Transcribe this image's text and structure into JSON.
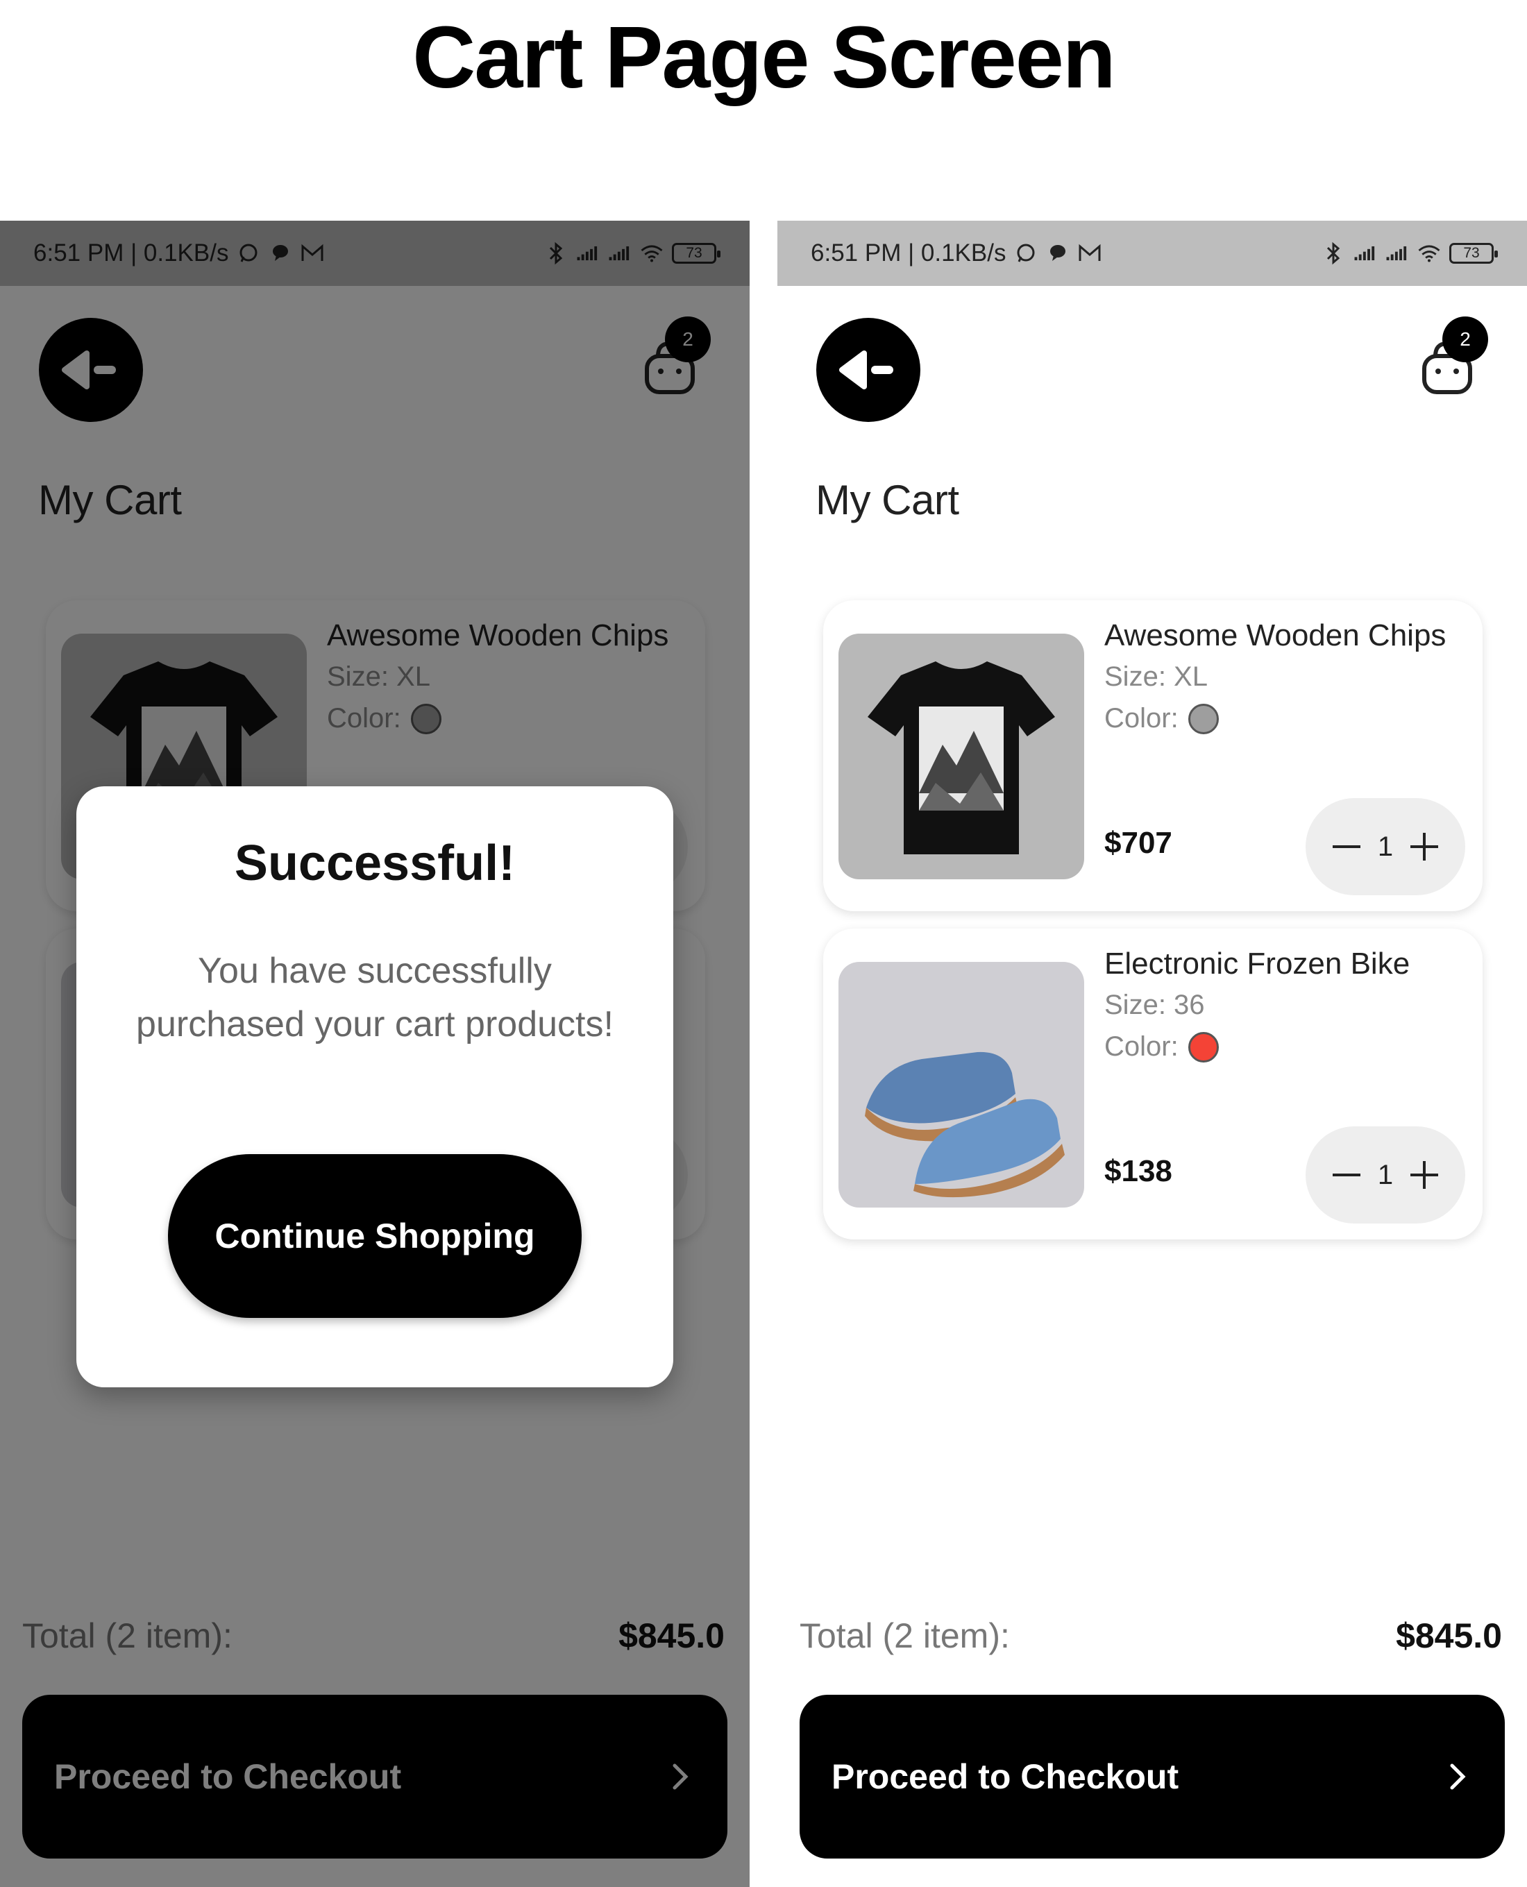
{
  "heading": "Cart Page Screen",
  "status_bar": {
    "time_speed": "6:51 PM | 0.1KB/s",
    "battery": "73"
  },
  "cart": {
    "badge_count": "2",
    "title": "My Cart",
    "items": [
      {
        "name": "Awesome Wooden Chips",
        "size": "Size: XL",
        "color_label": "Color:",
        "color": "#9e9e9e",
        "price": "$707",
        "quantity": "1",
        "image_icon": "tshirt-image"
      },
      {
        "name": "Electronic Frozen Bike",
        "size": "Size: 36",
        "color_label": "Color:",
        "color": "#f44336",
        "price": "$138",
        "quantity": "1",
        "image_icon": "shoe-image"
      }
    ],
    "total_label": "Total (2 item):",
    "total_value": "$845.0",
    "checkout_label": "Proceed to Checkout"
  },
  "dialog": {
    "title": "Successful!",
    "message": "You have successfully purchased your cart products!",
    "button_label": "Continue Shopping"
  },
  "colors": {
    "primary": "#000000",
    "overlay": "rgba(0,0,0,0.5)",
    "stepper_bg": "#eeeeee",
    "status_bar_bg": "#bdbdbd"
  }
}
